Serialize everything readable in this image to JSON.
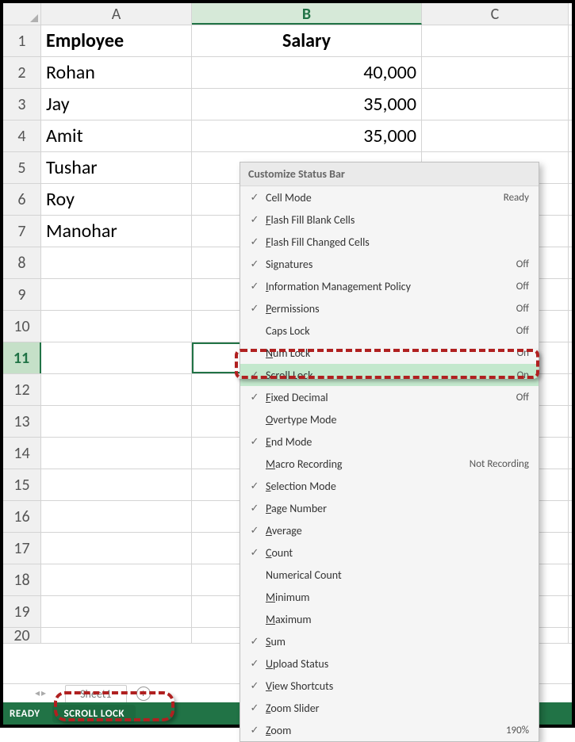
{
  "columns": [
    "A",
    "B",
    "C"
  ],
  "headers": {
    "A": "Employee",
    "B": "Salary"
  },
  "rows": [
    {
      "num": "1",
      "A": "Employee",
      "B": "Salary",
      "isHeader": true
    },
    {
      "num": "2",
      "A": "Rohan",
      "B": "40,000"
    },
    {
      "num": "3",
      "A": "Jay",
      "B": "35,000"
    },
    {
      "num": "4",
      "A": "Amit",
      "B": "35,000"
    },
    {
      "num": "5",
      "A": "Tushar",
      "B": ""
    },
    {
      "num": "6",
      "A": "Roy",
      "B": ""
    },
    {
      "num": "7",
      "A": "Manohar",
      "B": ""
    },
    {
      "num": "8",
      "A": "",
      "B": ""
    },
    {
      "num": "9",
      "A": "",
      "B": ""
    },
    {
      "num": "10",
      "A": "",
      "B": ""
    },
    {
      "num": "11",
      "A": "",
      "B": "",
      "selected": true
    },
    {
      "num": "12",
      "A": "",
      "B": ""
    },
    {
      "num": "13",
      "A": "",
      "B": ""
    },
    {
      "num": "14",
      "A": "",
      "B": ""
    },
    {
      "num": "15",
      "A": "",
      "B": ""
    },
    {
      "num": "16",
      "A": "",
      "B": ""
    },
    {
      "num": "17",
      "A": "",
      "B": ""
    },
    {
      "num": "18",
      "A": "",
      "B": ""
    },
    {
      "num": "19",
      "A": "",
      "B": ""
    },
    {
      "num": "20",
      "A": "",
      "B": ""
    }
  ],
  "sheetTab": "Sheet1",
  "statusBar": {
    "ready": "READY",
    "scrollLock": "SCROLL LOCK"
  },
  "contextMenu": {
    "title": "Customize Status Bar",
    "items": [
      {
        "checked": true,
        "label": "Cell Mode",
        "u": null,
        "value": "Ready"
      },
      {
        "checked": true,
        "label": "Flash Fill Blank Cells",
        "u": "F",
        "value": ""
      },
      {
        "checked": true,
        "label": "Flash Fill Changed Cells",
        "u": "F",
        "value": ""
      },
      {
        "checked": true,
        "label": "Signatures",
        "u": null,
        "value": "Off"
      },
      {
        "checked": true,
        "label": "Information Management Policy",
        "u": "I",
        "value": "Off"
      },
      {
        "checked": true,
        "label": "Permissions",
        "u": "P",
        "value": "Off"
      },
      {
        "checked": false,
        "label": "Caps Lock",
        "u": null,
        "value": "Off"
      },
      {
        "checked": false,
        "label": "Num Lock",
        "u": "N",
        "value": "On"
      },
      {
        "checked": true,
        "label": "Scroll Lock",
        "u": null,
        "value": "On",
        "highlighted": true
      },
      {
        "checked": true,
        "label": "Fixed Decimal",
        "u": "F",
        "value": "Off"
      },
      {
        "checked": false,
        "label": "Overtype Mode",
        "u": "O",
        "value": ""
      },
      {
        "checked": true,
        "label": "End Mode",
        "u": "E",
        "value": ""
      },
      {
        "checked": false,
        "label": "Macro Recording",
        "u": "M",
        "value": "Not Recording"
      },
      {
        "checked": true,
        "label": "Selection Mode",
        "u": "S",
        "value": ""
      },
      {
        "checked": true,
        "label": "Page Number",
        "u": "P",
        "value": ""
      },
      {
        "checked": true,
        "label": "Average",
        "u": "A",
        "value": ""
      },
      {
        "checked": true,
        "label": "Count",
        "u": "C",
        "value": ""
      },
      {
        "checked": false,
        "label": "Numerical Count",
        "u": null,
        "value": ""
      },
      {
        "checked": false,
        "label": "Minimum",
        "u": "M",
        "value": ""
      },
      {
        "checked": false,
        "label": "Maximum",
        "u": "M",
        "value": ""
      },
      {
        "checked": true,
        "label": "Sum",
        "u": "S",
        "value": ""
      },
      {
        "checked": true,
        "label": "Upload Status",
        "u": "U",
        "value": ""
      },
      {
        "checked": true,
        "label": "View Shortcuts",
        "u": "V",
        "value": ""
      },
      {
        "checked": true,
        "label": "Zoom Slider",
        "u": "Z",
        "value": ""
      },
      {
        "checked": true,
        "label": "Zoom",
        "u": "Z",
        "value": "190%"
      }
    ]
  }
}
